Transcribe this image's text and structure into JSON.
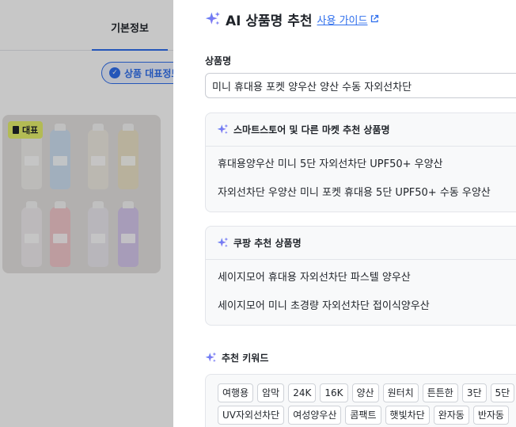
{
  "background": {
    "tab_basic_info": "기본정보",
    "rep_info_chip": "상품 대표정보",
    "image_badge": "대표"
  },
  "panel": {
    "title": "AI 상품명 추천",
    "guide_link": "사용 가이드",
    "name_label": "상품명",
    "name_value": "미니 휴대용 포켓 양우산 양산 수동 자외선차단",
    "smartstore": {
      "title": "스마트스토어 및 다른 마켓 추천 상품명",
      "items": [
        "휴대용양우산 미니 5단 자외선차단 UPF50+ 우양산",
        "자외선차단 우양산 미니 포켓 휴대용 5단 UPF50+ 수동 우양산"
      ]
    },
    "coupang": {
      "title": "쿠팡 추천 상품명",
      "items": [
        "세이지모어 휴대용 자외선차단 파스텔 양우산",
        "세이지모어 미니 초경량 자외선차단 접이식양우산"
      ]
    },
    "keywords": {
      "title": "추천 키워드",
      "row1": [
        "여행용",
        "암막",
        "24K",
        "16K",
        "양산",
        "원터치",
        "튼튼한",
        "3단",
        "5단"
      ],
      "row2": [
        "UV자외선차단",
        "여성양우산",
        "콤팩트",
        "햇빛차단",
        "완자동",
        "반자동"
      ]
    }
  },
  "icons": {
    "ai_sparkle": "sparkle-icon",
    "external_link": "external-link-icon",
    "check": "check-circle-icon",
    "bookmark": "bookmark-icon"
  },
  "colors": {
    "accent": "#2f6fed",
    "sparkle_start": "#4f7cf7",
    "sparkle_end": "#9b7bf0",
    "badge": "#e6f06c"
  }
}
